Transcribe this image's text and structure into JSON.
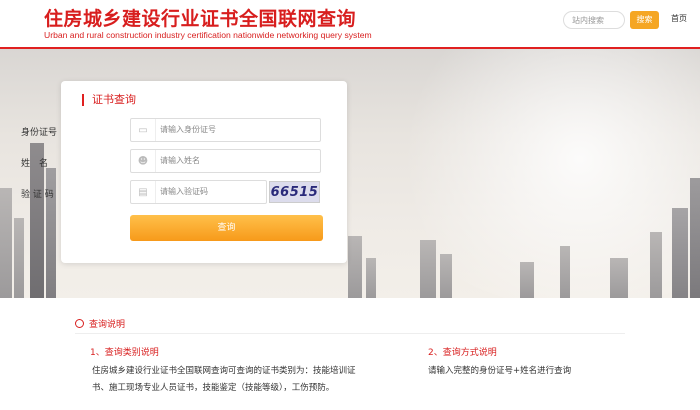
{
  "header": {
    "title_cn": "住房城乡建设行业证书全国联网查询",
    "title_en": "Urban and rural construction industry certification nationwide networking query system",
    "search_placeholder": "站内搜索",
    "search_button": "搜索",
    "home_link": "首页"
  },
  "query_card": {
    "title": "证书查询",
    "id_label": "身份证号",
    "id_placeholder": "请输入身份证号",
    "name_label": "姓　名",
    "name_placeholder": "请输入姓名",
    "captcha_label": "验 证 码",
    "captcha_placeholder": "请输入验证码",
    "captcha_value": "66515",
    "submit_label": "查询"
  },
  "explanation": {
    "title": "查询说明",
    "category_title": "1、查询类别说明",
    "category_text_1": "住房城乡建设行业证书全国联网查询可查询的证书类别为：技能培训证",
    "category_text_2": "书、施工现场专业人员证书，技能鉴定（技能等级），工伤预防。",
    "method_title": "2、查询方式说明",
    "method_text": "请输入完整的身份证号+姓名进行查询"
  },
  "colors": {
    "brand_red": "#d81e1e",
    "button_orange": "#f5a623"
  }
}
